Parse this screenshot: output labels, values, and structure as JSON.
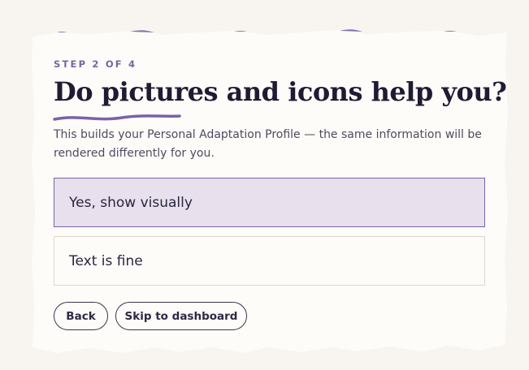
{
  "step_label": "STEP 2 OF 4",
  "title": "Do pictures and icons help you?",
  "subtitle": "This builds your Personal Adaptation Profile — the same information will be rendered differently for you.",
  "options": [
    {
      "label": "Yes, show visually",
      "selected": true
    },
    {
      "label": "Text is fine",
      "selected": false
    }
  ],
  "buttons": {
    "back": "Back",
    "skip": "Skip to dashboard"
  },
  "colors": {
    "background": "#f8f4ef",
    "card": "#fefcf8",
    "accent": "#7a62a8",
    "selected_option": "#e8e0ec",
    "heading": "#1f1b33"
  }
}
